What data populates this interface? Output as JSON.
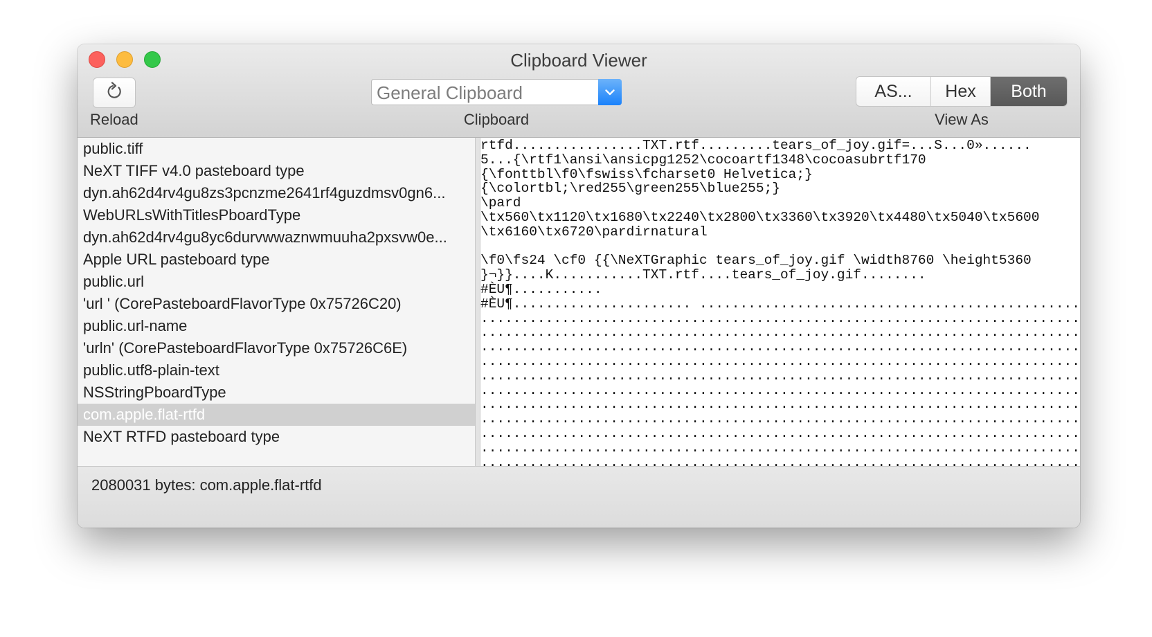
{
  "window": {
    "title": "Clipboard Viewer"
  },
  "toolbar": {
    "reload": {
      "label": "Reload",
      "icon": "reload-icon"
    },
    "clipboard": {
      "selected": "General Clipboard",
      "label": "Clipboard"
    },
    "view_as": {
      "label": "View As",
      "options": [
        "AS...",
        "Hex",
        "Both"
      ],
      "selected": "Both"
    }
  },
  "types": [
    {
      "label": "public.tiff",
      "selected": false
    },
    {
      "label": "NeXT TIFF v4.0 pasteboard type",
      "selected": false
    },
    {
      "label": "dyn.ah62d4rv4gu8zs3pcnzme2641rf4guzdmsv0gn6...",
      "selected": false
    },
    {
      "label": "WebURLsWithTitlesPboardType",
      "selected": false
    },
    {
      "label": "dyn.ah62d4rv4gu8yc6durvwwaznwmuuha2pxsvw0e...",
      "selected": false
    },
    {
      "label": "Apple URL pasteboard type",
      "selected": false
    },
    {
      "label": "public.url",
      "selected": false
    },
    {
      "label": "'url ' (CorePasteboardFlavorType 0x75726C20)",
      "selected": false
    },
    {
      "label": "public.url-name",
      "selected": false
    },
    {
      "label": "'urln' (CorePasteboardFlavorType 0x75726C6E)",
      "selected": false
    },
    {
      "label": "public.utf8-plain-text",
      "selected": false
    },
    {
      "label": "NSStringPboardType",
      "selected": false
    },
    {
      "label": "com.apple.flat-rtfd",
      "selected": true
    },
    {
      "label": "NeXT RTFD pasteboard type",
      "selected": false
    }
  ],
  "content_lines": [
    "rtfd................TXT.rtf.........tears_of_joy.gif=...S...0»......",
    "5...{\\rtf1\\ansi\\ansicpg1252\\cocoartf1348\\cocoasubrtf170",
    "{\\fonttbl\\f0\\fswiss\\fcharset0 Helvetica;}",
    "{\\colortbl;\\red255\\green255\\blue255;}",
    "\\pard",
    "\\tx560\\tx1120\\tx1680\\tx2240\\tx2800\\tx3360\\tx3920\\tx4480\\tx5040\\tx5600",
    "\\tx6160\\tx6720\\pardirnatural",
    "",
    "\\f0\\fs24 \\cf0 {{\\NeXTGraphic tears_of_joy.gif \\width8760 \\height5360",
    "}¬}}....K...........TXT.rtf....tears_of_joy.gif........",
    "#ÈU¶...........",
    "#ÈU¶...................... ...................................................",
    "..........................................................................",
    "..........................................................................",
    "..........................................................................",
    "..........................................................................",
    "..........................................................................",
    "..........................................................................",
    "..........................................................................",
    "..........................................................................",
    "..........................................................................",
    "..........................................................................",
    ".........................................................................."
  ],
  "status": {
    "text": "2080031 bytes: com.apple.flat-rtfd"
  }
}
